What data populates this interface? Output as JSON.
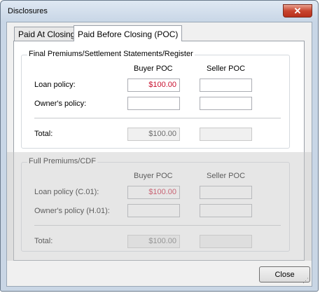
{
  "window": {
    "title": "Disclosures",
    "close_glyph": "✕"
  },
  "tabs": [
    {
      "label": "Paid At Closing"
    },
    {
      "label": "Paid Before Closing (POC)"
    }
  ],
  "final_group": {
    "label": "Final Premiums/Settlement Statements/Register",
    "col_buyer": "Buyer POC",
    "col_seller": "Seller POC",
    "rows": [
      {
        "label": "Loan policy:",
        "buyer": "$100.00",
        "seller": ""
      },
      {
        "label": "Owner's policy:",
        "buyer": "",
        "seller": ""
      }
    ],
    "total_label": "Total:",
    "total_buyer": "$100.00",
    "total_seller": ""
  },
  "full_group": {
    "label": "Full Premiums/CDF",
    "col_buyer": "Buyer POC",
    "col_seller": "Seller POC",
    "rows": [
      {
        "label": "Loan policy (C.01):",
        "buyer": "$100.00",
        "seller": ""
      },
      {
        "label": "Owner's policy (H.01):",
        "buyer": "",
        "seller": ""
      }
    ],
    "total_label": "Total:",
    "total_buyer": "$100.00",
    "total_seller": ""
  },
  "buttons": {
    "close": "Close"
  },
  "colors": {
    "accent_red": "#c8102e",
    "window_frame": "#c9d6e5"
  }
}
